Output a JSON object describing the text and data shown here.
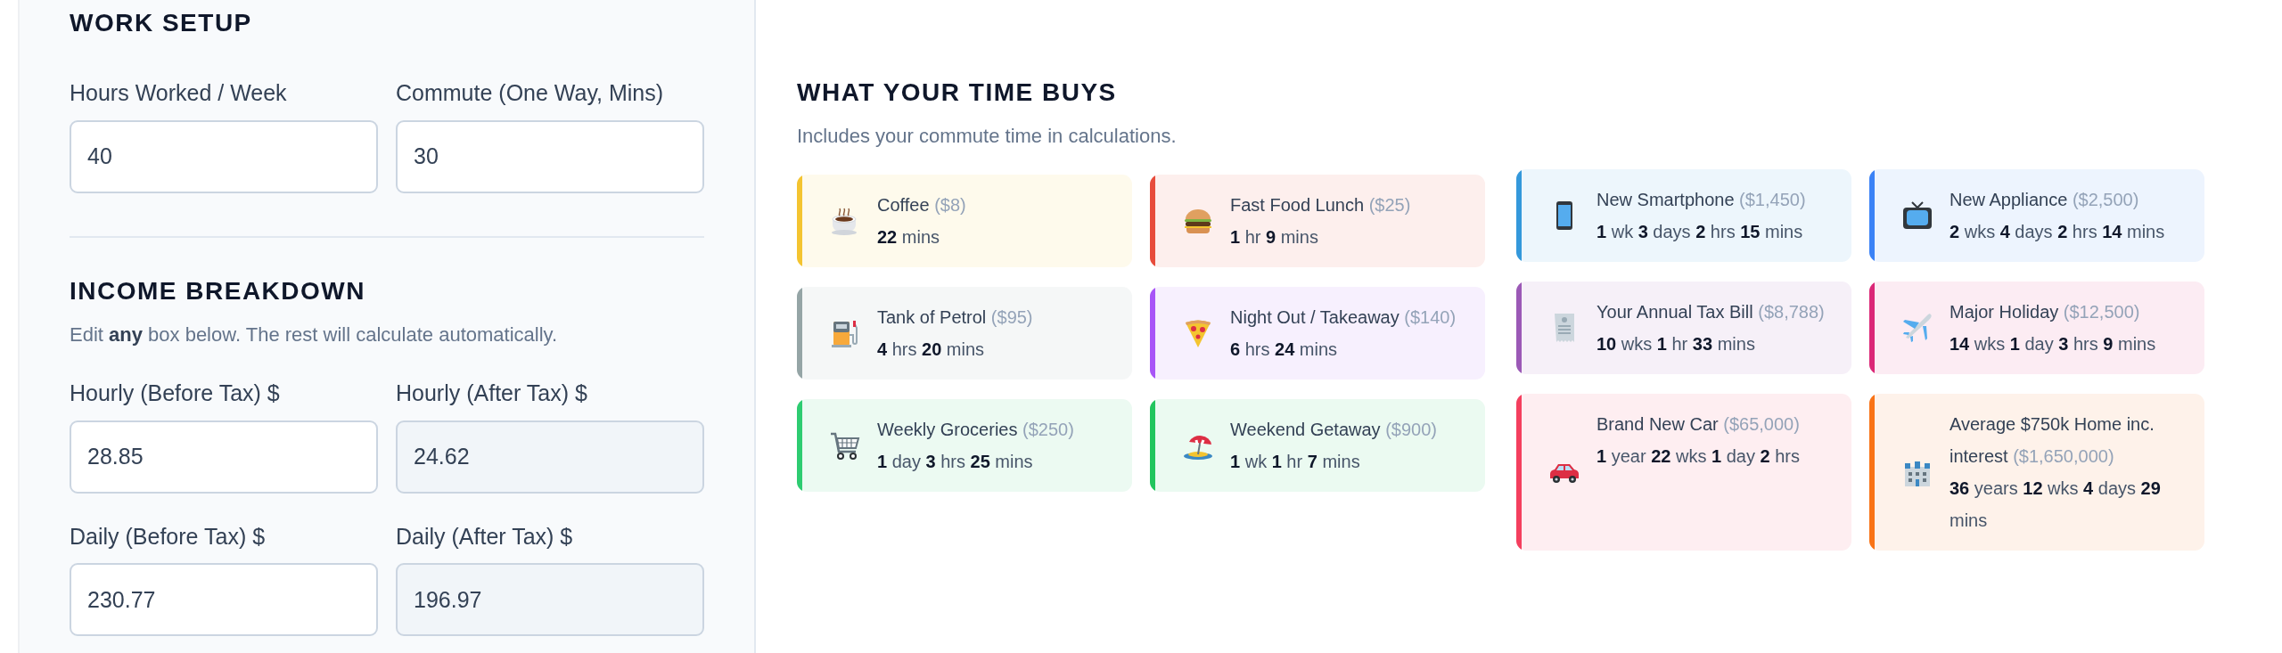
{
  "work_setup": {
    "title": "WORK SETUP",
    "fields": [
      {
        "label": "Hours Worked / Week",
        "value": "40",
        "readonly": false
      },
      {
        "label": "Commute (One Way, Mins)",
        "value": "30",
        "readonly": false
      }
    ]
  },
  "income_breakdown": {
    "title": "INCOME BREAKDOWN",
    "note": "Edit **any** box below. The rest will calculate automatically.",
    "fields": [
      {
        "label": "Hourly (Before Tax) $",
        "value": "28.85",
        "readonly": false
      },
      {
        "label": "Hourly (After Tax) $",
        "value": "24.62",
        "readonly": true
      },
      {
        "label": "Daily (Before Tax) $",
        "value": "230.77",
        "readonly": false
      },
      {
        "label": "Daily (After Tax) $",
        "value": "196.97",
        "readonly": true
      }
    ]
  },
  "time_buys": {
    "title": "WHAT YOUR TIME BUYS",
    "subtitle": "Includes your commute time in calculations.",
    "groups": [
      {
        "items": [
          {
            "kind": "coffee",
            "name": "Coffee",
            "price": "($8)",
            "time": "**22** mins",
            "color": "#f4c430"
          },
          {
            "kind": "burger",
            "name": "Fast Food Lunch",
            "price": "($25)",
            "time": "**1** hr **9** mins",
            "color": "#e74c3c"
          },
          {
            "kind": "fuel",
            "name": "Tank of Petrol",
            "price": "($95)",
            "time": "**4** hrs **20** mins",
            "color": "#95a5a6"
          },
          {
            "kind": "pizza",
            "name": "Night Out / Takeaway",
            "price": "($140)",
            "time": "**6** hrs **24** mins",
            "color": "#a855f7"
          },
          {
            "kind": "cart",
            "name": "Weekly Groceries",
            "price": "($250)",
            "time": "**1** day **3** hrs **25** mins",
            "color": "#2ecc71"
          },
          {
            "kind": "beach",
            "name": "Weekend Getaway",
            "price": "($900)",
            "time": "**1** wk **1** hr **7** mins",
            "color": "#22c55e"
          }
        ]
      },
      {
        "items": [
          {
            "kind": "phone",
            "name": "New Smartphone",
            "price": "($1,450)",
            "time": "**1** wk **3** days **2** hrs **15** mins",
            "color": "#3498db"
          },
          {
            "kind": "tv",
            "name": "New Appliance",
            "price": "($2,500)",
            "time": "**2** wks **4** days **2** hrs **14** mins",
            "color": "#3b82f6"
          },
          {
            "kind": "receipt",
            "name": "Your Annual Tax Bill",
            "price": "($8,788)",
            "time": "**10** wks **1** hr **33** mins",
            "color": "#9b59b6"
          },
          {
            "kind": "plane",
            "name": "Major Holiday",
            "price": "($12,500)",
            "time": "**14** wks **1** day **3** hrs **9** mins",
            "color": "#db2777"
          },
          {
            "kind": "car",
            "name": "Brand New Car",
            "price": "($65,000)",
            "time": "**1** year **22** wks **1** day **2** hrs",
            "color": "#f43f5e"
          },
          {
            "kind": "house",
            "name": "Average $750k Home inc. interest",
            "price": "($1,650,000)",
            "time": "**36** years **12** wks **4** days **29** mins",
            "color": "#f97316"
          }
        ]
      }
    ]
  }
}
